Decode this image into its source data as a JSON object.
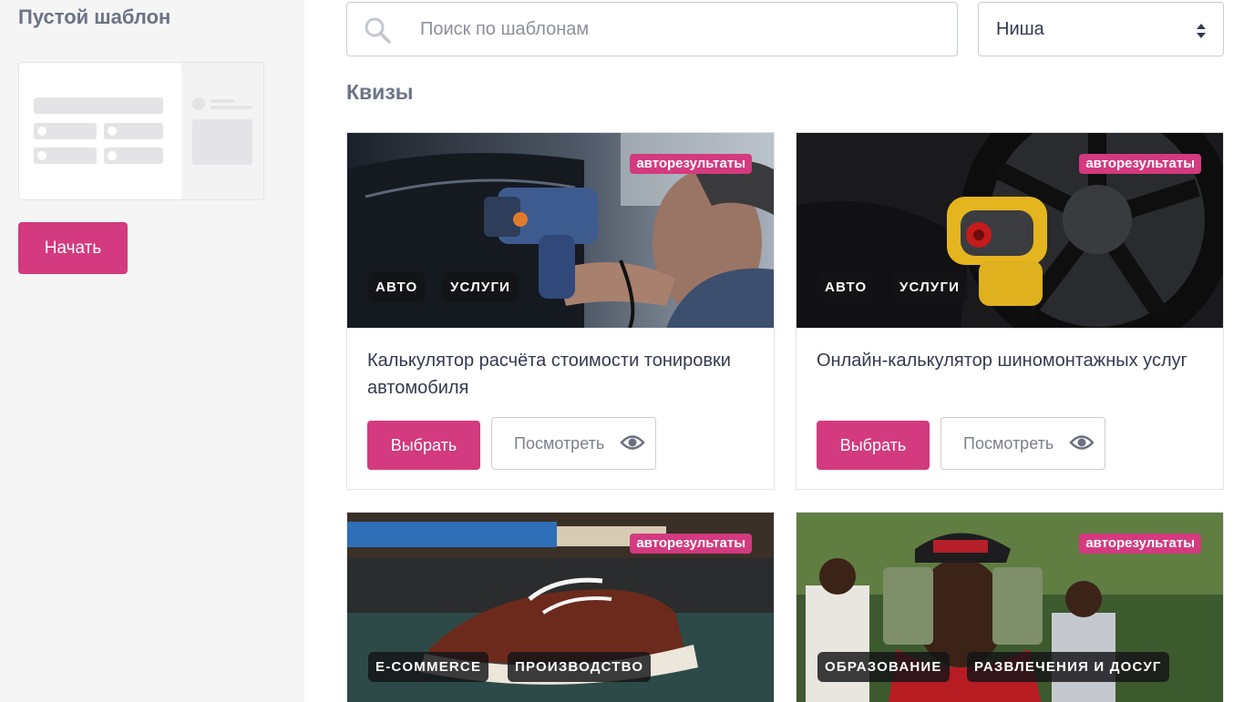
{
  "sidebar": {
    "title": "Пустой шаблон",
    "start_label": "Начать"
  },
  "search": {
    "placeholder": "Поиск по шаблонам",
    "icon": "search-icon"
  },
  "niche_select": {
    "selected": "Ниша"
  },
  "section_title": "Квизы",
  "cards": [
    {
      "badge": "авторезультаты",
      "tags": [
        "АВТО",
        "УСЛУГИ"
      ],
      "title": "Калькулятор расчёта стоимости тонировки автомобиля",
      "choose_label": "Выбрать",
      "view_label": "Посмотреть"
    },
    {
      "badge": "авторезультаты",
      "tags": [
        "АВТО",
        "УСЛУГИ"
      ],
      "title": "Онлайн-калькулятор шиномонтажных услуг",
      "choose_label": "Выбрать",
      "view_label": "Посмотреть"
    },
    {
      "badge": "авторезультаты",
      "tags": [
        "E-COMMERCE",
        "ПРОИЗВОДСТВО"
      ]
    },
    {
      "badge": "авторезультаты",
      "tags": [
        "ОБРАЗОВАНИЕ",
        "РАЗВЛЕЧЕНИЯ И ДОСУГ"
      ]
    }
  ],
  "colors": {
    "accent": "#d33a7f",
    "sidebar_bg": "#f5f5f6",
    "heading": "#6b7385"
  }
}
